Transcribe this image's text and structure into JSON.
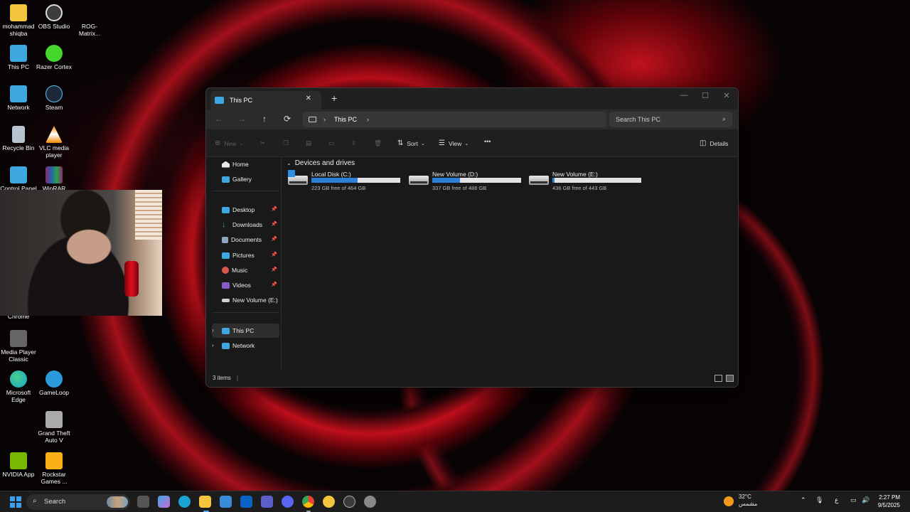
{
  "desktop": {
    "icons": [
      {
        "label": "mohammad shiqba",
        "color": "#f2c53d"
      },
      {
        "label": "OBS Studio",
        "color": "#3c3c3c"
      },
      {
        "label": "ROG-Matrix...",
        "color": "#2a0a0c"
      },
      {
        "label": "This PC",
        "color": "#3fa7e0"
      },
      {
        "label": "Razer Cortex",
        "color": "#44d62c"
      },
      {
        "label": "Network",
        "color": "#3fa7e0"
      },
      {
        "label": "Steam",
        "color": "#1b2838"
      },
      {
        "label": "Recycle Bin",
        "color": "#b7c4cf"
      },
      {
        "label": "VLC media player",
        "color": "#f08a00"
      },
      {
        "label": "Control Panel",
        "color": "#3fa7e0"
      },
      {
        "label": "WinRAR",
        "color": "#8b2a6e"
      },
      {
        "label": "Chrome",
        "color": "#4285f4"
      },
      {
        "label": "Media Player Classic",
        "color": "#666666"
      },
      {
        "label": "Microsoft Edge",
        "color": "#1aa2d0"
      },
      {
        "label": "GameLoop",
        "color": "#2a9bd8"
      },
      {
        "label": "Grand Theft Auto V",
        "color": "#aaaaaa"
      },
      {
        "label": "NVIDIA App",
        "color": "#76b900"
      },
      {
        "label": "Rockstar Games ...",
        "color": "#fcaf17"
      }
    ]
  },
  "explorer": {
    "tab_title": "This PC",
    "tab_close": "✕",
    "new_tab": "+",
    "controls": {
      "minimize": "—",
      "maximize": "☐",
      "close": "✕"
    },
    "nav": {
      "back": "←",
      "forward": "→",
      "up": "↑",
      "refresh": "⟳"
    },
    "breadcrumb": {
      "location": "This PC"
    },
    "search_placeholder": "Search This PC",
    "toolbar": {
      "new": "New",
      "sort": "Sort",
      "view": "View",
      "more": "•••",
      "details": "Details"
    },
    "sidebar": {
      "home": "Home",
      "gallery": "Gallery",
      "desktop": "Desktop",
      "downloads": "Downloads",
      "documents": "Documents",
      "pictures": "Pictures",
      "music": "Music",
      "videos": "Videos",
      "new_volume": "New Volume (E:)",
      "this_pc": "This PC",
      "network": "Network"
    },
    "section_title": "Devices and drives",
    "drives": [
      {
        "name": "Local Disk (C:)",
        "free": "223 GB free of 464 GB",
        "used_fraction": 0.52
      },
      {
        "name": "New Volume (D:)",
        "free": "337 GB free of 488 GB",
        "used_fraction": 0.31
      },
      {
        "name": "New Volume (E:)",
        "free": "436 GB free of 443 GB",
        "used_fraction": 0.02
      }
    ],
    "status": "3 items"
  },
  "taskbar": {
    "search_label": "Search",
    "weather_temp": "32°C",
    "weather_desc": "مشمس",
    "lang": "ع",
    "time": "2:27 PM",
    "date": "9/5/2025"
  }
}
